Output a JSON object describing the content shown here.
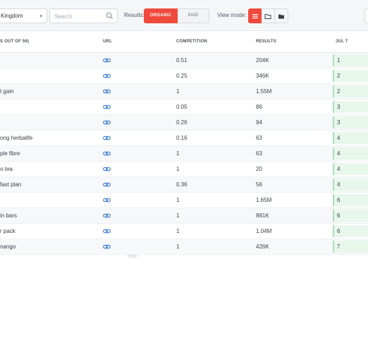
{
  "toolbar": {
    "country_value": "Kingdom",
    "search_placeholder": "Search",
    "results_label": "Results:",
    "organic_label": "ORGANIC",
    "paid_label": "PAID",
    "view_mode_label": "View mode:",
    "accent_color": "#ef4a3c"
  },
  "table": {
    "headers": {
      "keyword": "S OUT OF 56)",
      "url": "URL",
      "competition": "COMPETITION",
      "results": "RESULTS",
      "date": "JUL 7"
    },
    "rows": [
      {
        "keyword": "",
        "competition": "0.51",
        "results": "204K",
        "rank": "1"
      },
      {
        "keyword": "",
        "competition": "0.25",
        "results": "346K",
        "rank": "2"
      },
      {
        "keyword": "t gain",
        "competition": "1",
        "results": "1.55M",
        "rank": "2"
      },
      {
        "keyword": "",
        "competition": "0.05",
        "results": "86",
        "rank": "3"
      },
      {
        "keyword": "",
        "competition": "0.26",
        "results": "94",
        "rank": "3"
      },
      {
        "keyword": "ong herbalife",
        "competition": "0.16",
        "results": "63",
        "rank": "4"
      },
      {
        "keyword": "ple fibre",
        "competition": "1",
        "results": "63",
        "rank": "4"
      },
      {
        "keyword": "o tea",
        "competition": "1",
        "results": "20",
        "rank": "4"
      },
      {
        "keyword": "fast plan",
        "competition": "0.36",
        "results": "56",
        "rank": "4"
      },
      {
        "keyword": "",
        "competition": "1",
        "results": "1.65M",
        "rank": "6"
      },
      {
        "keyword": "in bars",
        "competition": "1",
        "results": "881K",
        "rank": "6"
      },
      {
        "keyword": "r pack",
        "competition": "1",
        "results": "1.04M",
        "rank": "6"
      },
      {
        "keyword": "nango",
        "competition": "1",
        "results": "426K",
        "rank": "7"
      }
    ]
  }
}
